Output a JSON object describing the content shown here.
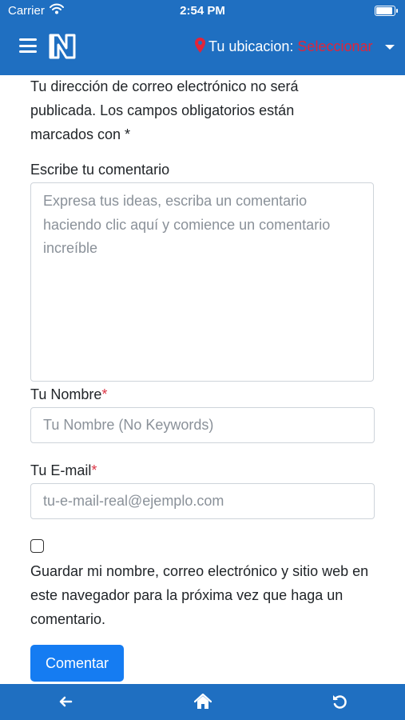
{
  "status_bar": {
    "carrier": "Carrier",
    "time": "2:54 PM"
  },
  "navbar": {
    "location_label": "Tu ubicacion:",
    "location_value": "Seleccionar",
    "icons": [
      "menu-icon",
      "logo-icon",
      "location-pin-icon",
      "chevron-down-icon"
    ]
  },
  "form": {
    "notice": "Tu dirección de correo electrónico no será publicada. Los campos obligatorios están marcados con *",
    "comment_label": "Escribe tu comentario",
    "comment_placeholder": "Expresa tus ideas, escriba un comentario haciendo clic aquí y comience un comentario increíble",
    "name_label": "Tu Nombre",
    "name_placeholder": "Tu Nombre (No Keywords)",
    "email_label": "Tu E-mail",
    "email_placeholder": "tu-e-mail-real@ejemplo.com",
    "required_mark": "*",
    "save_info_label": "Guardar mi nombre, correo electrónico y sitio web en este navegador para la próxima vez que haga un comentario.",
    "submit_label": "Comentar"
  },
  "bottom_bar": {
    "icons": [
      "back-arrow-icon",
      "home-icon",
      "reload-icon"
    ]
  },
  "colors": {
    "primary": "#1f6fc1",
    "button": "#157cf2",
    "required": "#dc3545",
    "location_value": "#e0253a"
  }
}
